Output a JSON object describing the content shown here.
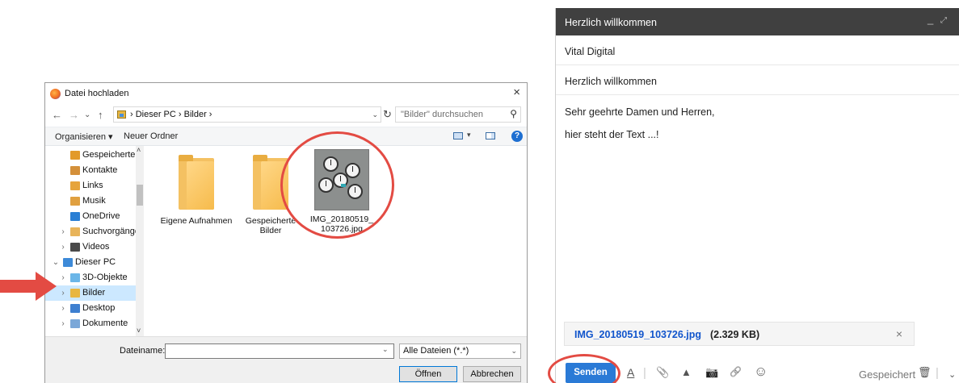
{
  "dialog": {
    "title": "Datei hochladen",
    "close": "×",
    "nav": {
      "back": "←",
      "forward": "→",
      "recent": "⌄",
      "up": "↑"
    },
    "address": "› Dieser PC › Bilder ›",
    "address_dropdown": "⌄",
    "refresh": "↻",
    "search_placeholder": "\"Bilder\" durchsuchen",
    "search_icon": "⚲",
    "toolbar": {
      "organize": "Organisieren ▾",
      "new_folder": "Neuer Ordner",
      "view_dropdown": "▾",
      "help": "?"
    },
    "nav_items": [
      {
        "label": "Gespeicherte S",
        "chevron": "",
        "icon_color": "#e29a2a"
      },
      {
        "label": "Kontakte",
        "chevron": "",
        "icon_color": "#d4903a"
      },
      {
        "label": "Links",
        "chevron": "",
        "icon_color": "#e6a43b"
      },
      {
        "label": "Musik",
        "chevron": "",
        "icon_color": "#e0a040"
      },
      {
        "label": "OneDrive",
        "chevron": "",
        "icon_color": "#2a7fd4"
      },
      {
        "label": "Suchvorgänge",
        "chevron": "›",
        "icon_color": "#e8b45a"
      },
      {
        "label": "Videos",
        "chevron": "›",
        "icon_color": "#4a4a4a"
      },
      {
        "label": "Dieser PC",
        "chevron": "⌄",
        "icon_color": "#3d8ad8"
      },
      {
        "label": "3D-Objekte",
        "chevron": "›",
        "icon_color": "#6bb6e8"
      },
      {
        "label": "Bilder",
        "chevron": "›",
        "icon_color": "#e8b640"
      },
      {
        "label": "Desktop",
        "chevron": "›",
        "icon_color": "#3d7fd0"
      },
      {
        "label": "Dokumente",
        "chevron": "›",
        "icon_color": "#7aa7d8"
      }
    ],
    "scroll": {
      "up": "˄",
      "down": "˅"
    },
    "files": [
      {
        "name": "Eigene Aufnahmen",
        "type": "folder"
      },
      {
        "name": "Gespeicherte Bilder",
        "type": "folder"
      },
      {
        "name": "IMG_20180519_103726.jpg",
        "type": "image"
      }
    ],
    "filename_label": "Dateiname:",
    "filename_value": "",
    "filename_dropdown": "⌄",
    "filetype": "Alle Dateien (*.*)",
    "filetype_dropdown": "⌄",
    "open_button": "Öffnen",
    "cancel_button": "Abbrechen"
  },
  "compose": {
    "header_title": "Herzlich willkommen",
    "header_minimize": "_",
    "header_expand": "⤢",
    "recipient": "Vital Digital",
    "subject": "Herzlich willkommen",
    "body_lines": [
      "Sehr geehrte Damen und Herren,",
      "hier steht der Text ...!"
    ],
    "attachment": {
      "name": "IMG_20180519_103726.jpg",
      "size": "(2.329 KB)",
      "remove": "×"
    },
    "send_button": "Senden",
    "toolbar": {
      "format": "A",
      "attach": "📎",
      "drive": "▲",
      "photo": "📷",
      "link": "🔗",
      "emoji": "☺",
      "trash": "🗑",
      "more": "⌄"
    },
    "saved_status": "Gespeichert"
  },
  "annotations": {
    "highlight_color": "#e34b43"
  }
}
